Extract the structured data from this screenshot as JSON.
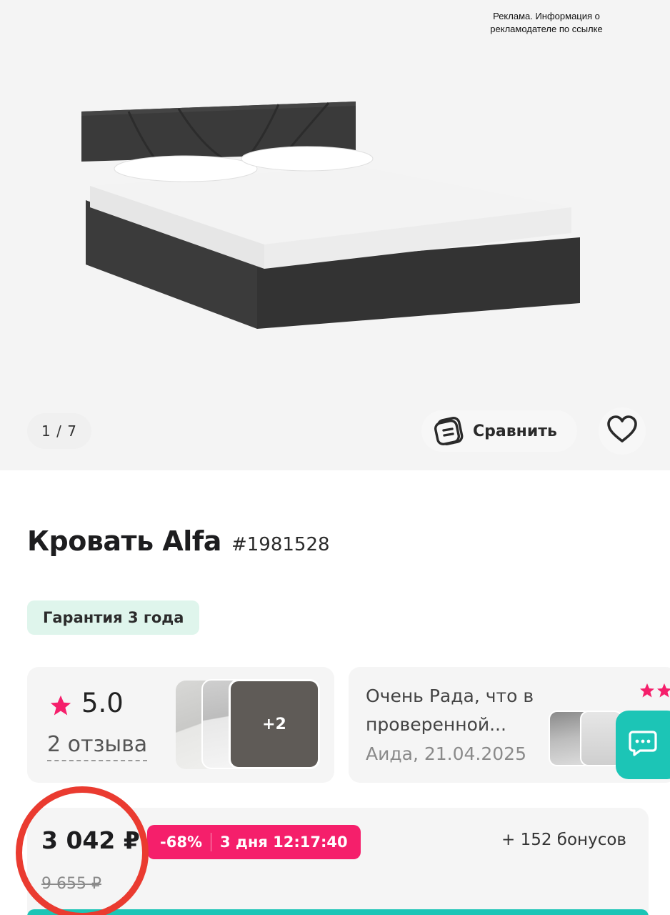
{
  "ad": {
    "notice": "Реклама. Информация о рекламодателе по ссылке"
  },
  "gallery": {
    "counter": "1 / 7",
    "compare_label": "Сравнить"
  },
  "product": {
    "name": "Кровать Alfa",
    "sku": "#1981528",
    "warranty": "Гарантия 3 года"
  },
  "rating": {
    "value": "5.0",
    "reviews": "2 отзыва",
    "more_photos": "+2"
  },
  "review": {
    "text": "Очень Рада, что в проверенной...",
    "author_date": "Аида, 21.04.2025"
  },
  "price": {
    "current": "3 042 ₽",
    "old": "9 655 ₽",
    "discount": "-68%",
    "timer": "3 дня 12:17:40",
    "bonus": "+ 152 бонусов"
  },
  "colors": {
    "accent_pink": "#f51f6b",
    "accent_teal": "#1cc5b6",
    "warranty_bg": "#dff5ec",
    "annotation_red": "#ea3b30"
  },
  "icons": [
    "compare-icon",
    "heart-icon",
    "star-icon",
    "chat-icon"
  ]
}
